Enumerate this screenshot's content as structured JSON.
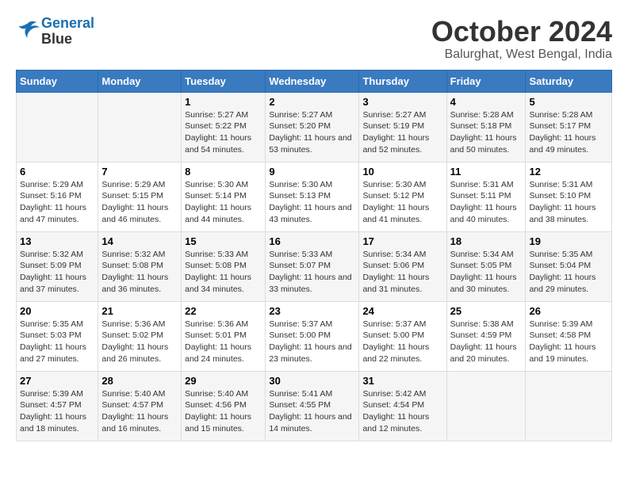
{
  "logo": {
    "line1": "General",
    "line2": "Blue"
  },
  "title": "October 2024",
  "subtitle": "Balurghat, West Bengal, India",
  "headers": [
    "Sunday",
    "Monday",
    "Tuesday",
    "Wednesday",
    "Thursday",
    "Friday",
    "Saturday"
  ],
  "weeks": [
    [
      {
        "day": "",
        "sunrise": "",
        "sunset": "",
        "daylight": ""
      },
      {
        "day": "",
        "sunrise": "",
        "sunset": "",
        "daylight": ""
      },
      {
        "day": "1",
        "sunrise": "Sunrise: 5:27 AM",
        "sunset": "Sunset: 5:22 PM",
        "daylight": "Daylight: 11 hours and 54 minutes."
      },
      {
        "day": "2",
        "sunrise": "Sunrise: 5:27 AM",
        "sunset": "Sunset: 5:20 PM",
        "daylight": "Daylight: 11 hours and 53 minutes."
      },
      {
        "day": "3",
        "sunrise": "Sunrise: 5:27 AM",
        "sunset": "Sunset: 5:19 PM",
        "daylight": "Daylight: 11 hours and 52 minutes."
      },
      {
        "day": "4",
        "sunrise": "Sunrise: 5:28 AM",
        "sunset": "Sunset: 5:18 PM",
        "daylight": "Daylight: 11 hours and 50 minutes."
      },
      {
        "day": "5",
        "sunrise": "Sunrise: 5:28 AM",
        "sunset": "Sunset: 5:17 PM",
        "daylight": "Daylight: 11 hours and 49 minutes."
      }
    ],
    [
      {
        "day": "6",
        "sunrise": "Sunrise: 5:29 AM",
        "sunset": "Sunset: 5:16 PM",
        "daylight": "Daylight: 11 hours and 47 minutes."
      },
      {
        "day": "7",
        "sunrise": "Sunrise: 5:29 AM",
        "sunset": "Sunset: 5:15 PM",
        "daylight": "Daylight: 11 hours and 46 minutes."
      },
      {
        "day": "8",
        "sunrise": "Sunrise: 5:30 AM",
        "sunset": "Sunset: 5:14 PM",
        "daylight": "Daylight: 11 hours and 44 minutes."
      },
      {
        "day": "9",
        "sunrise": "Sunrise: 5:30 AM",
        "sunset": "Sunset: 5:13 PM",
        "daylight": "Daylight: 11 hours and 43 minutes."
      },
      {
        "day": "10",
        "sunrise": "Sunrise: 5:30 AM",
        "sunset": "Sunset: 5:12 PM",
        "daylight": "Daylight: 11 hours and 41 minutes."
      },
      {
        "day": "11",
        "sunrise": "Sunrise: 5:31 AM",
        "sunset": "Sunset: 5:11 PM",
        "daylight": "Daylight: 11 hours and 40 minutes."
      },
      {
        "day": "12",
        "sunrise": "Sunrise: 5:31 AM",
        "sunset": "Sunset: 5:10 PM",
        "daylight": "Daylight: 11 hours and 38 minutes."
      }
    ],
    [
      {
        "day": "13",
        "sunrise": "Sunrise: 5:32 AM",
        "sunset": "Sunset: 5:09 PM",
        "daylight": "Daylight: 11 hours and 37 minutes."
      },
      {
        "day": "14",
        "sunrise": "Sunrise: 5:32 AM",
        "sunset": "Sunset: 5:08 PM",
        "daylight": "Daylight: 11 hours and 36 minutes."
      },
      {
        "day": "15",
        "sunrise": "Sunrise: 5:33 AM",
        "sunset": "Sunset: 5:08 PM",
        "daylight": "Daylight: 11 hours and 34 minutes."
      },
      {
        "day": "16",
        "sunrise": "Sunrise: 5:33 AM",
        "sunset": "Sunset: 5:07 PM",
        "daylight": "Daylight: 11 hours and 33 minutes."
      },
      {
        "day": "17",
        "sunrise": "Sunrise: 5:34 AM",
        "sunset": "Sunset: 5:06 PM",
        "daylight": "Daylight: 11 hours and 31 minutes."
      },
      {
        "day": "18",
        "sunrise": "Sunrise: 5:34 AM",
        "sunset": "Sunset: 5:05 PM",
        "daylight": "Daylight: 11 hours and 30 minutes."
      },
      {
        "day": "19",
        "sunrise": "Sunrise: 5:35 AM",
        "sunset": "Sunset: 5:04 PM",
        "daylight": "Daylight: 11 hours and 29 minutes."
      }
    ],
    [
      {
        "day": "20",
        "sunrise": "Sunrise: 5:35 AM",
        "sunset": "Sunset: 5:03 PM",
        "daylight": "Daylight: 11 hours and 27 minutes."
      },
      {
        "day": "21",
        "sunrise": "Sunrise: 5:36 AM",
        "sunset": "Sunset: 5:02 PM",
        "daylight": "Daylight: 11 hours and 26 minutes."
      },
      {
        "day": "22",
        "sunrise": "Sunrise: 5:36 AM",
        "sunset": "Sunset: 5:01 PM",
        "daylight": "Daylight: 11 hours and 24 minutes."
      },
      {
        "day": "23",
        "sunrise": "Sunrise: 5:37 AM",
        "sunset": "Sunset: 5:00 PM",
        "daylight": "Daylight: 11 hours and 23 minutes."
      },
      {
        "day": "24",
        "sunrise": "Sunrise: 5:37 AM",
        "sunset": "Sunset: 5:00 PM",
        "daylight": "Daylight: 11 hours and 22 minutes."
      },
      {
        "day": "25",
        "sunrise": "Sunrise: 5:38 AM",
        "sunset": "Sunset: 4:59 PM",
        "daylight": "Daylight: 11 hours and 20 minutes."
      },
      {
        "day": "26",
        "sunrise": "Sunrise: 5:39 AM",
        "sunset": "Sunset: 4:58 PM",
        "daylight": "Daylight: 11 hours and 19 minutes."
      }
    ],
    [
      {
        "day": "27",
        "sunrise": "Sunrise: 5:39 AM",
        "sunset": "Sunset: 4:57 PM",
        "daylight": "Daylight: 11 hours and 18 minutes."
      },
      {
        "day": "28",
        "sunrise": "Sunrise: 5:40 AM",
        "sunset": "Sunset: 4:57 PM",
        "daylight": "Daylight: 11 hours and 16 minutes."
      },
      {
        "day": "29",
        "sunrise": "Sunrise: 5:40 AM",
        "sunset": "Sunset: 4:56 PM",
        "daylight": "Daylight: 11 hours and 15 minutes."
      },
      {
        "day": "30",
        "sunrise": "Sunrise: 5:41 AM",
        "sunset": "Sunset: 4:55 PM",
        "daylight": "Daylight: 11 hours and 14 minutes."
      },
      {
        "day": "31",
        "sunrise": "Sunrise: 5:42 AM",
        "sunset": "Sunset: 4:54 PM",
        "daylight": "Daylight: 11 hours and 12 minutes."
      },
      {
        "day": "",
        "sunrise": "",
        "sunset": "",
        "daylight": ""
      },
      {
        "day": "",
        "sunrise": "",
        "sunset": "",
        "daylight": ""
      }
    ]
  ]
}
